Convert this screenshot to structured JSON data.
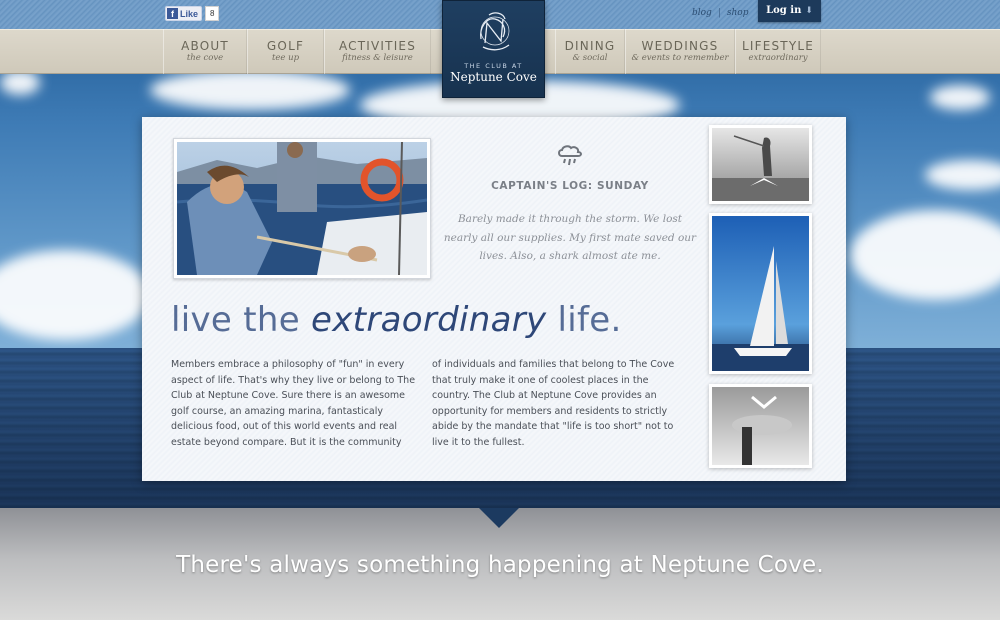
{
  "brand": {
    "small_text": "THE CLUB AT",
    "name": "Neptune Cove"
  },
  "facebook": {
    "like_label": "Like",
    "count": "8"
  },
  "top_links": {
    "blog": "blog",
    "separator": "|",
    "shop": "shop"
  },
  "login": {
    "label": "Log in"
  },
  "nav": {
    "left": [
      {
        "main": "ABOUT",
        "sub": "the cove"
      },
      {
        "main": "GOLF",
        "sub": "tee up"
      },
      {
        "main": "ACTIVITIES",
        "sub": "fitness & leisure"
      }
    ],
    "right": [
      {
        "main": "DINING",
        "sub": "& social"
      },
      {
        "main": "WEDDINGS",
        "sub": "& events to remember"
      },
      {
        "main": "LIFESTYLE",
        "sub": "extraordinary"
      }
    ]
  },
  "captains_log": {
    "title": "CAPTAIN'S LOG: SUNDAY",
    "body": "Barely made it through the storm. We lost nearly all our supplies. My first mate saved our lives. Also, a shark almost ate me."
  },
  "headline": {
    "part1": "live the ",
    "part2": "extraordinary",
    "part3": " life."
  },
  "body": {
    "col1": "Members embrace a philosophy of \"fun\" in every aspect of life. That's why they live or belong to The Club at Neptune Cove. Sure there is an awesome golf course, an amazing marina, fantasticaly delicious food, out of this world events and real estate beyond compare. But it is the community",
    "col2": "of individuals and families that belong to The Cove that truly make it one of coolest places in the country. The Club at Neptune Cove provides an opportunity for members and residents to strictly abide by the mandate that \"life is too short\" not to live it to the fullest."
  },
  "footer": {
    "tagline": "There's always something happening at Neptune Cove."
  },
  "icons": {
    "weather": "cloud-rain-icon",
    "login_arrow": "arrow-down-icon",
    "facebook": "facebook-icon"
  },
  "colors": {
    "navy": "#1d3a5b",
    "headline": "#2e4778",
    "nav_bg": "#d6d1c3"
  }
}
